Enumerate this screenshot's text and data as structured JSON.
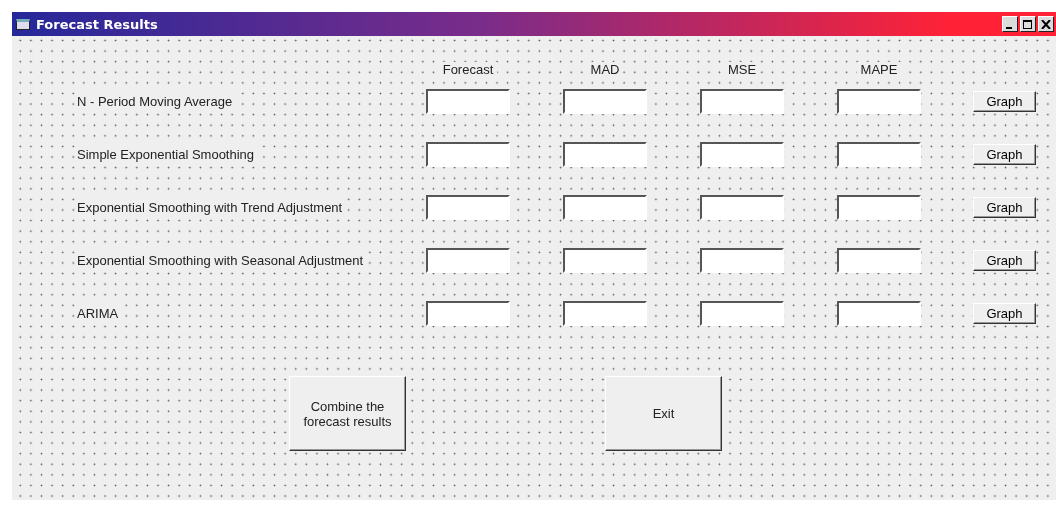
{
  "window": {
    "title": "Forecast Results"
  },
  "columns": [
    "Forecast",
    "MAD",
    "MSE",
    "MAPE"
  ],
  "methods": [
    {
      "label": "N - Period Moving Average",
      "button": "Graph"
    },
    {
      "label": "Simple Exponential Smoothing",
      "button": "Graph"
    },
    {
      "label": "Exponential Smoothing with Trend Adjustment",
      "button": "Graph"
    },
    {
      "label": "Exponential Smoothing with Seasonal Adjustment",
      "button": "Graph"
    },
    {
      "label": "ARIMA",
      "button": "Graph"
    }
  ],
  "buttons": [
    "Combine the forecast results",
    "Exit"
  ]
}
